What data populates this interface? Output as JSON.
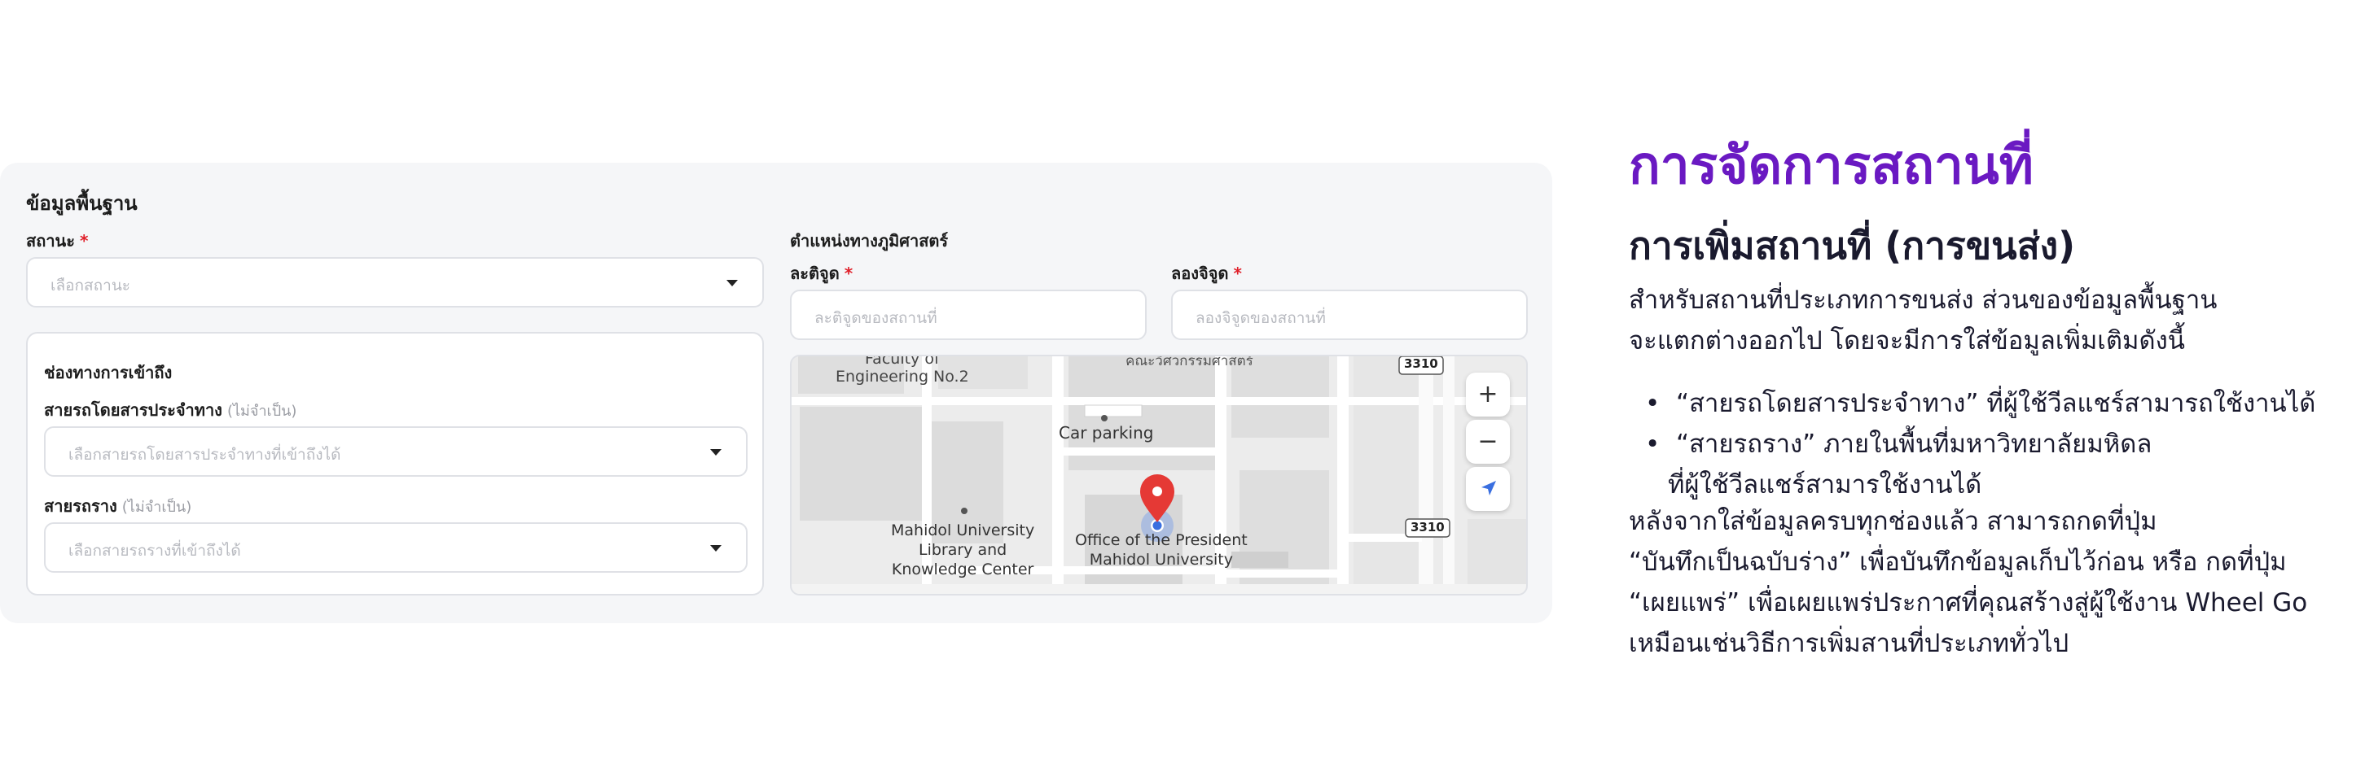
{
  "form": {
    "section_title": "ข้อมูลพื้นฐาน",
    "status_label": "สถานะ",
    "required_mark": "*",
    "status_placeholder": "เลือกสถานะ",
    "access": {
      "title": "ช่องทางการเข้าถึง",
      "bus_label": "สายรถโดยสารประจำทาง",
      "bus_optional": "(ไม่จำเป็น)",
      "bus_placeholder": "เลือกสายรถโดยสารประจำทางที่เข้าถึงได้",
      "rail_label": "สายรถราง",
      "rail_optional": "(ไม่จำเป็น)",
      "rail_placeholder": "เลือกสายรถรางที่เข้าถึงได้"
    },
    "geo": {
      "title": "ตำแหน่งทางภูมิศาสตร์",
      "lat_label": "ละติจูด",
      "lat_placeholder": "ละติจูดของสถานที่",
      "lng_label": "ลองจิจูด",
      "lng_placeholder": "ลองจิจูดของสถานที่"
    },
    "map": {
      "labels": {
        "engineering": [
          "Faculty of",
          "Engineering No.2"
        ],
        "science": "คณะวิศวกรรมศาสตร์",
        "car_parking": "Car parking",
        "library": [
          "Mahidol University",
          "Library and",
          "Knowledge Center"
        ],
        "office": [
          "Office of the President",
          "Mahidol University"
        ],
        "road_3310_top": "3310",
        "road_3310_mid": "3310"
      },
      "zoom_in": "+",
      "zoom_out": "−",
      "locate_icon": "navigation-arrow-icon",
      "pin_icon": "map-pin-icon",
      "pin_color": "#e53935"
    }
  },
  "description": {
    "title": "การจัดการสถานที่",
    "subtitle": "การเพิ่มสถานที่ (การขนส่ง)",
    "intro": [
      "สำหรับสถานที่ประเภทการขนส่ง ส่วนของข้อมูลพื้นฐาน",
      "จะแตกต่างออกไป โดยจะมีการใส่ข้อมูลเพิ่มเติมดังนี้"
    ],
    "bullets": [
      "“สายรถโดยสารประจำทาง” ที่ผู้ใช้วีลแชร์สามารถใช้งานได้",
      "“สายรถราง” ภายในพื้นที่มหาวิทยาลัยมหิดล",
      "ที่ผู้ใช้วีลแชร์สามารใช้งานได้"
    ],
    "outro": [
      "หลังจากใส่ข้อมูลครบทุกช่องแล้ว สามารถกดที่ปุ่ม",
      "“บันทึกเป็นฉบับร่าง” เพื่อบันทึกข้อมูลเก็บไว้ก่อน หรือ กดที่ปุ่ม",
      "“เผยแพร่” เพื่อเผยแพร่ประกาศที่คุณสร้างสู่ผู้ใช้งาน Wheel Go",
      "เหมือนเช่นวิธีการเพิ่มสานที่ประเภททั่วไป"
    ],
    "title_color": "#6a19c2"
  }
}
